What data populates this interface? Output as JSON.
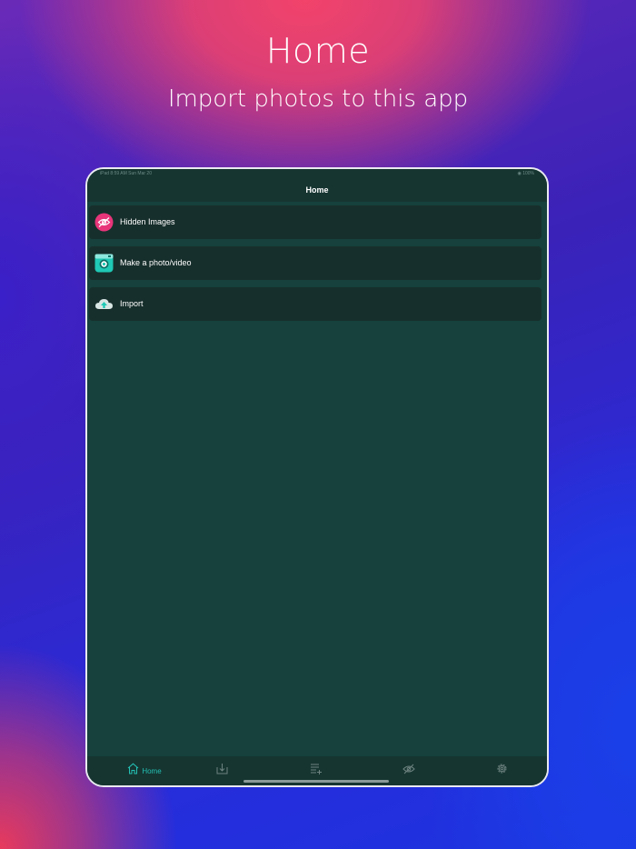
{
  "promo": {
    "title": "Home",
    "subtitle": "Import photos to this app"
  },
  "status_bar": {
    "left": "iPad  8:59 AM  Sun Mar 20",
    "right": "100%"
  },
  "navbar": {
    "title": "Home"
  },
  "menu": {
    "items": [
      {
        "label": "Hidden Images",
        "icon": "hidden-eye-icon"
      },
      {
        "label": "Make a photo/video",
        "icon": "camera-icon"
      },
      {
        "label": "Import",
        "icon": "cloud-upload-icon"
      }
    ]
  },
  "tabbar": {
    "tabs": [
      {
        "label": "Home",
        "icon": "home-icon",
        "active": true
      },
      {
        "label": "",
        "icon": "download-icon",
        "active": false
      },
      {
        "label": "",
        "icon": "playlist-add-icon",
        "active": false
      },
      {
        "label": "",
        "icon": "eye-off-icon",
        "active": false
      },
      {
        "label": "",
        "icon": "gear-icon",
        "active": false
      }
    ]
  },
  "colors": {
    "accent": "#24c1b4",
    "screen_bg": "#16413d",
    "bar_bg": "#163531",
    "row_bg": "#172f2c",
    "hidden_icon_bg": "#e8357a",
    "camera_icon_bg": "#1fc9b5"
  }
}
